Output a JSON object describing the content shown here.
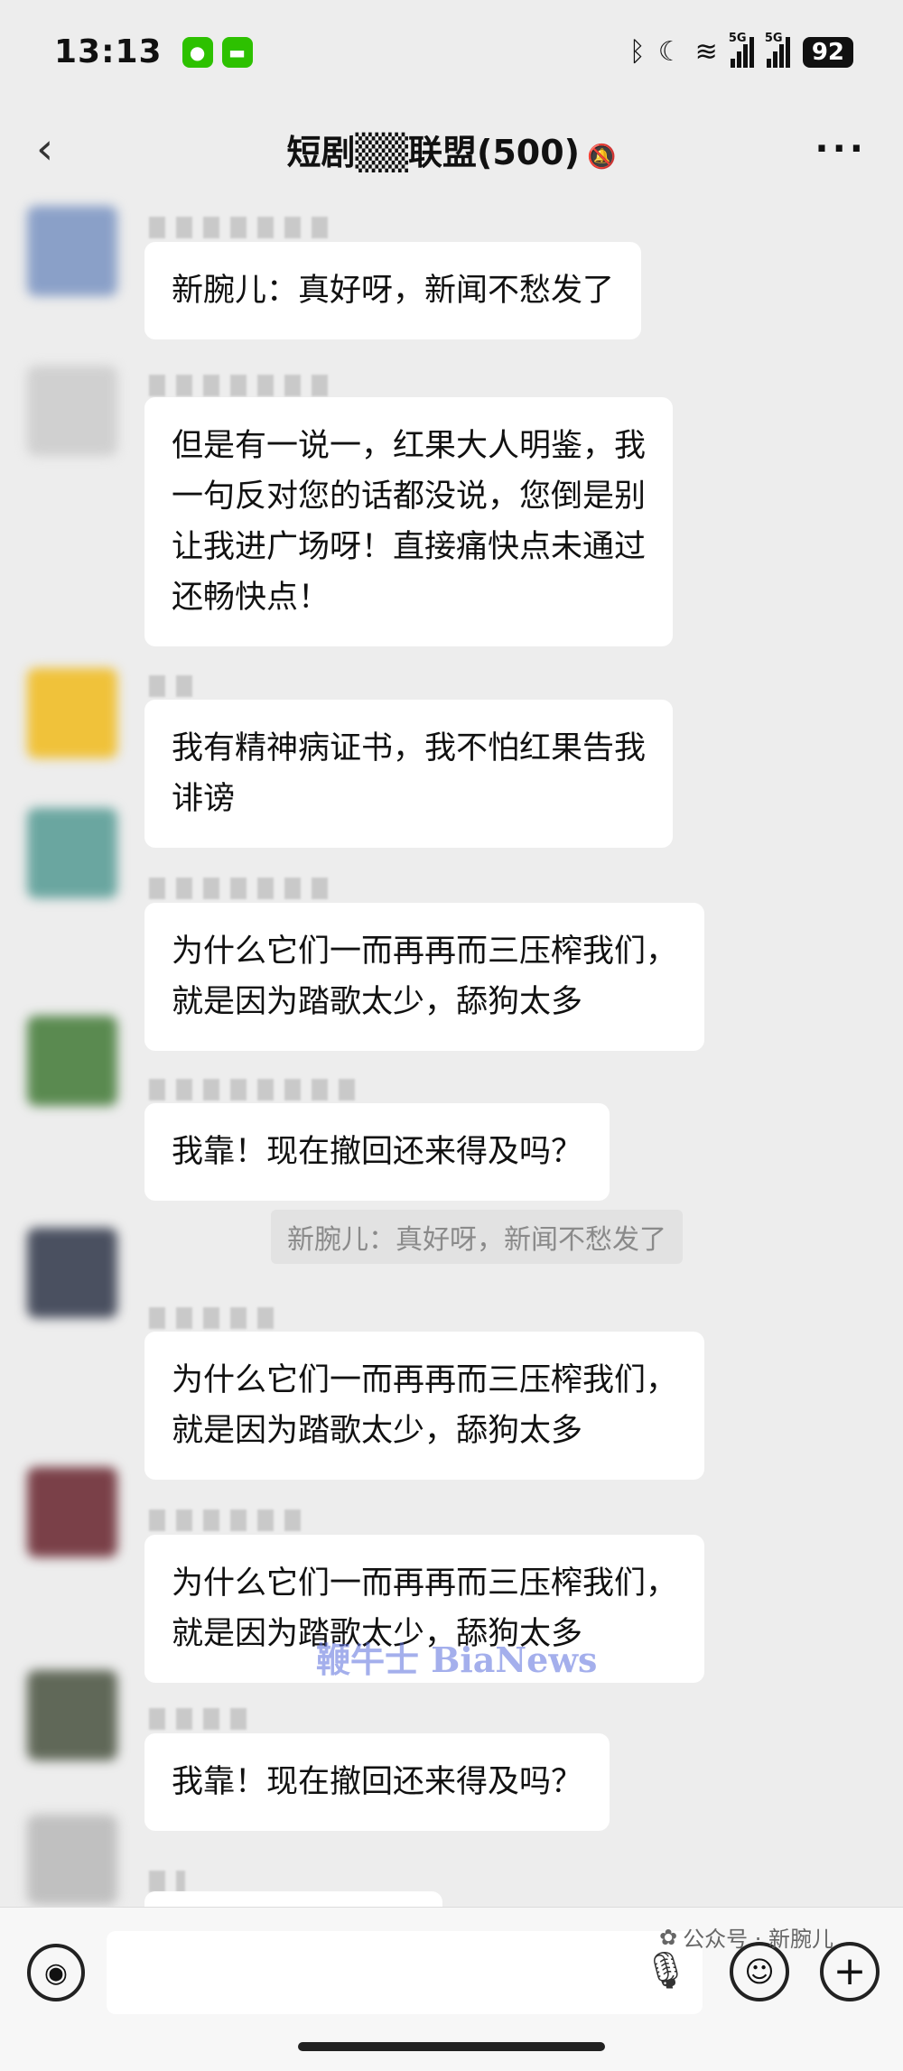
{
  "status": {
    "time": "13:13",
    "app_icons": [
      "wechat-icon",
      "message-icon"
    ],
    "signal_tag": "5G",
    "battery": "92"
  },
  "header": {
    "back": "‹",
    "title": "短剧▒▒联盟(500)",
    "mute": "🔕",
    "more": "···"
  },
  "messages": [
    {
      "text": "新腕儿：真好呀，新闻不愁发了",
      "avatar_color": "#8aa0c8"
    },
    {
      "text": "但是有一说一，红果大人明鉴，我\n一句反对您的话都没说，您倒是别\n让我进广场呀！直接痛快点未通过\n还畅快点！",
      "avatar_color": "#d0d0d0"
    },
    {
      "text": "我有精神病证书，我不怕红果告我\n诽谤",
      "avatar_color": "#f0c23a"
    },
    {
      "text": "为什么它们一而再再而三压榨我们，\n就是因为踏歌太少，舔狗太多",
      "avatar_color": "#6aa6a0"
    },
    {
      "text": "我靠！现在撤回还来得及吗？",
      "avatar_color": "#5a8a50",
      "quote": "新腕儿：真好呀，新闻不愁发了"
    },
    {
      "text": "为什么它们一而再再而三压榨我们，\n就是因为踏歌太少，舔狗太多",
      "avatar_color": "#4a5060"
    },
    {
      "text": "为什么它们一而再再而三压榨我们，\n就是因为踏歌太少，舔狗太多",
      "avatar_color": "#7a4048"
    },
    {
      "text": "我靠！现在撤回还来得及吗？",
      "avatar_color": "#606858"
    },
    {
      "text": "",
      "avatar_color": "#c0c0c0"
    }
  ],
  "watermark": "鞭牛士 BiaNews",
  "input": {
    "voice": "◉",
    "mic": "🎙",
    "emoji": "☺",
    "plus": "+"
  },
  "source_label": "公众号 · 新腕儿"
}
